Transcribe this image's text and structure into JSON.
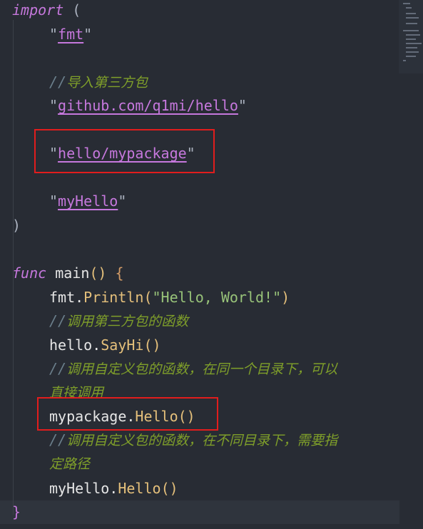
{
  "code": {
    "l1": {
      "kw": "import",
      "paren": "("
    },
    "l2": {
      "pkg": "fmt"
    },
    "l3": {
      "comment_slash": "//",
      "comment_text": "导入第三方包"
    },
    "l4": {
      "pkg": "github.com/q1mi/hello"
    },
    "l5": {
      "pkg": "hello/mypackage"
    },
    "l6": {
      "pkg": "myHello"
    },
    "l7": {
      "paren": ")"
    },
    "l8": {
      "kw": "func",
      "name": "main",
      "parens": "()",
      "brace": "{"
    },
    "l9": {
      "obj": "fmt",
      "dot": ".",
      "fn": "Println",
      "open": "(",
      "str": "\"Hello, World!\"",
      "close": ")"
    },
    "l10": {
      "comment_slash": "//",
      "comment_text": "调用第三方包的函数"
    },
    "l11": {
      "obj": "hello",
      "dot": ".",
      "fn": "SayHi",
      "parens": "()"
    },
    "l12": {
      "comment_slash": "//",
      "comment_text": "调用自定义包的函数，在同一个目录下，可以"
    },
    "l13": {
      "comment_text": "直接调用"
    },
    "l14": {
      "obj": "mypackage",
      "dot": ".",
      "fn": "Hello",
      "parens": "()"
    },
    "l15": {
      "comment_slash": "//",
      "comment_text": "调用自定义包的函数，在不同目录下，需要指"
    },
    "l16": {
      "comment_text": "定路径"
    },
    "l17": {
      "obj": "myHello",
      "dot": ".",
      "fn": "Hello",
      "parens": "()"
    },
    "l18": {
      "brace": "}"
    }
  },
  "quote": "\"",
  "colors": {
    "background": "#282c34",
    "keyword": "#c678dd",
    "function": "#e5c07b",
    "string": "#98c379",
    "comment": "#7f9f2a",
    "highlight_box": "#e11d1d"
  }
}
